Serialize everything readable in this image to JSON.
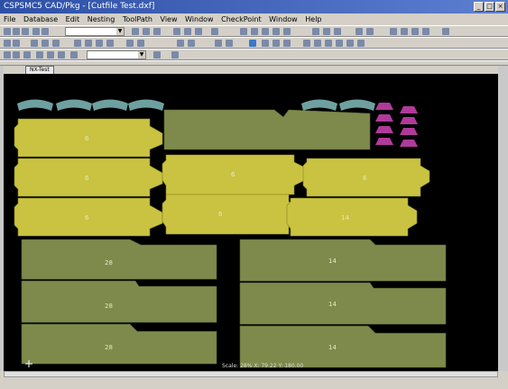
{
  "window": {
    "title": "CSPSMC5 CAD/Pkg - [Cutfile Test.dxf]"
  },
  "menu": [
    "File",
    "Database",
    "Edit",
    "Nesting",
    "ToolPath",
    "View",
    "Window",
    "CheckPoint",
    "Window",
    "Help"
  ],
  "toolbar": {
    "combo1": "",
    "combo2": ""
  },
  "tab": {
    "label": "NX-Test"
  },
  "status": {
    "coords": "Scale: 28% X: 79.22 Y: 180.00"
  },
  "pieces": {
    "yellow": [
      "6",
      "6",
      "6",
      "6",
      "6",
      "6",
      "14",
      "14"
    ],
    "green": [
      "28",
      "28",
      "28",
      "14",
      "14",
      "14"
    ]
  },
  "colors": {
    "yellow": "#c9c341",
    "olive": "#7d8a4c",
    "teal": "#6ea0a0",
    "magenta": "#b03a9a",
    "canvas": "#000000"
  }
}
